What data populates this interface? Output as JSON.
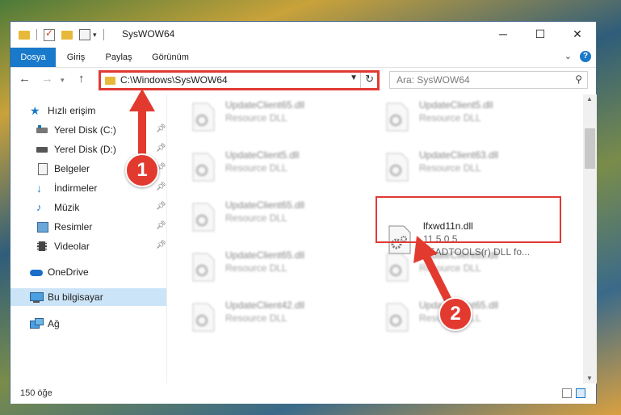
{
  "window": {
    "title": "SysWOW64"
  },
  "ribbon": {
    "tabs": [
      {
        "label": "Dosya",
        "active": true
      },
      {
        "label": "Giriş"
      },
      {
        "label": "Paylaş"
      },
      {
        "label": "Görünüm"
      }
    ]
  },
  "navbar": {
    "address": "C:\\Windows\\SysWOW64",
    "search_placeholder": "Ara: SysWOW64"
  },
  "sidebar": {
    "items": [
      {
        "label": "Hızlı erişim",
        "icon": "star-icon"
      },
      {
        "label": "Yerel Disk (C:)",
        "icon": "drive-icon",
        "pinned": true
      },
      {
        "label": "Yerel Disk (D:)",
        "icon": "drive-icon",
        "pinned": true
      },
      {
        "label": "Belgeler",
        "icon": "documents-icon",
        "pinned": true
      },
      {
        "label": "İndirmeler",
        "icon": "download-icon",
        "pinned": true
      },
      {
        "label": "Müzik",
        "icon": "music-icon",
        "pinned": true
      },
      {
        "label": "Resimler",
        "icon": "pictures-icon",
        "pinned": true
      },
      {
        "label": "Videolar",
        "icon": "video-icon",
        "pinned": true
      },
      {
        "label": "OneDrive",
        "icon": "cloud-icon"
      },
      {
        "label": "Bu bilgisayar",
        "icon": "computer-icon",
        "selected": true
      },
      {
        "label": "Ağ",
        "icon": "network-icon"
      }
    ]
  },
  "files": [
    {
      "name": "UpdateClient65.dll",
      "desc": "Resource DLL"
    },
    {
      "name": "UpdateClient5.dll",
      "desc": "Resource DLL"
    },
    {
      "name": "UpdateClient5.dll",
      "desc": "Resource DLL"
    },
    {
      "name": "UpdateClient63.dll",
      "desc": "Resource DLL"
    },
    {
      "name": "UpdateClient65.dll",
      "desc": "Resource DLL"
    },
    {
      "name": "lfxwd11n.dll",
      "version": "11.5.0.5",
      "desc": "LEADTOOLS(r) DLL fo...",
      "highlighted": true
    },
    {
      "name": "UpdateClient65.dll",
      "desc": "Resource DLL"
    },
    {
      "name": "UpdateClient65.dll",
      "desc": "Resource DLL"
    },
    {
      "name": "UpdateClient42.dll",
      "desc": "Resource DLL"
    },
    {
      "name": "UpdateClient65.dll",
      "desc": "Resource DLL"
    }
  ],
  "status": {
    "count": "150 öğe"
  },
  "annotations": {
    "step1": "1",
    "step2": "2",
    "color": "#e03a33"
  }
}
